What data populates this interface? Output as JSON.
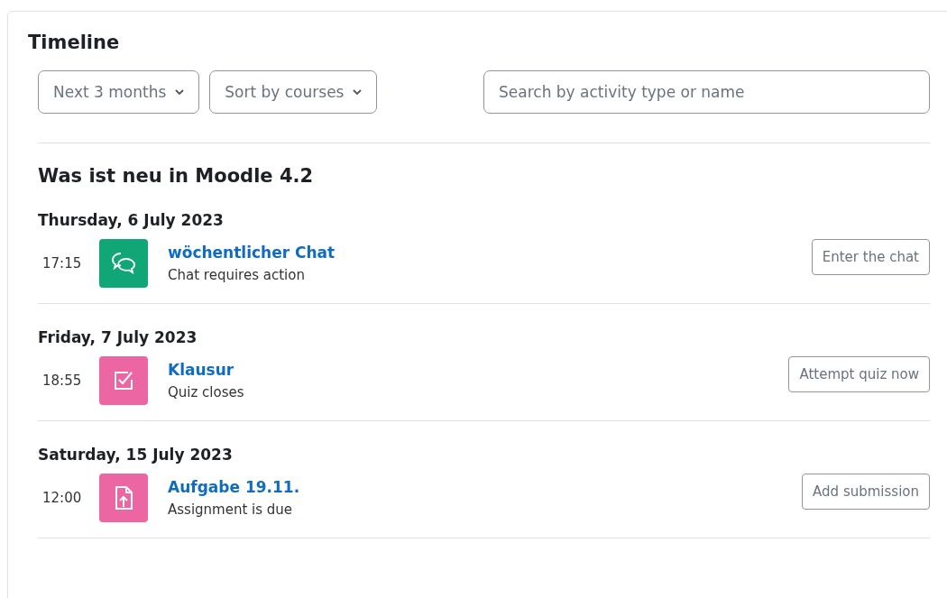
{
  "title": "Timeline",
  "filters": [
    {
      "label": "Next 3 months"
    },
    {
      "label": "Sort by courses"
    }
  ],
  "search": {
    "placeholder": "Search by activity type or name"
  },
  "course": "Was ist neu in Moodle 4.2",
  "days": [
    {
      "date": "Thursday, 6 July 2023",
      "events": [
        {
          "time": "17:15",
          "kind": "chat",
          "color": "#11a676",
          "name": "wöchentlicher Chat",
          "status": "Chat requires action",
          "action": "Enter the chat"
        }
      ]
    },
    {
      "date": "Friday, 7 July 2023",
      "events": [
        {
          "time": "18:55",
          "kind": "quiz",
          "color": "#eb66a2",
          "name": "Klausur",
          "status": "Quiz closes",
          "action": "Attempt quiz now"
        }
      ]
    },
    {
      "date": "Saturday, 15 July 2023",
      "events": [
        {
          "time": "12:00",
          "kind": "assign",
          "color": "#eb66a2",
          "name": "Aufgabe 19.11.",
          "status": "Assignment is due",
          "action": "Add submission"
        }
      ]
    }
  ]
}
